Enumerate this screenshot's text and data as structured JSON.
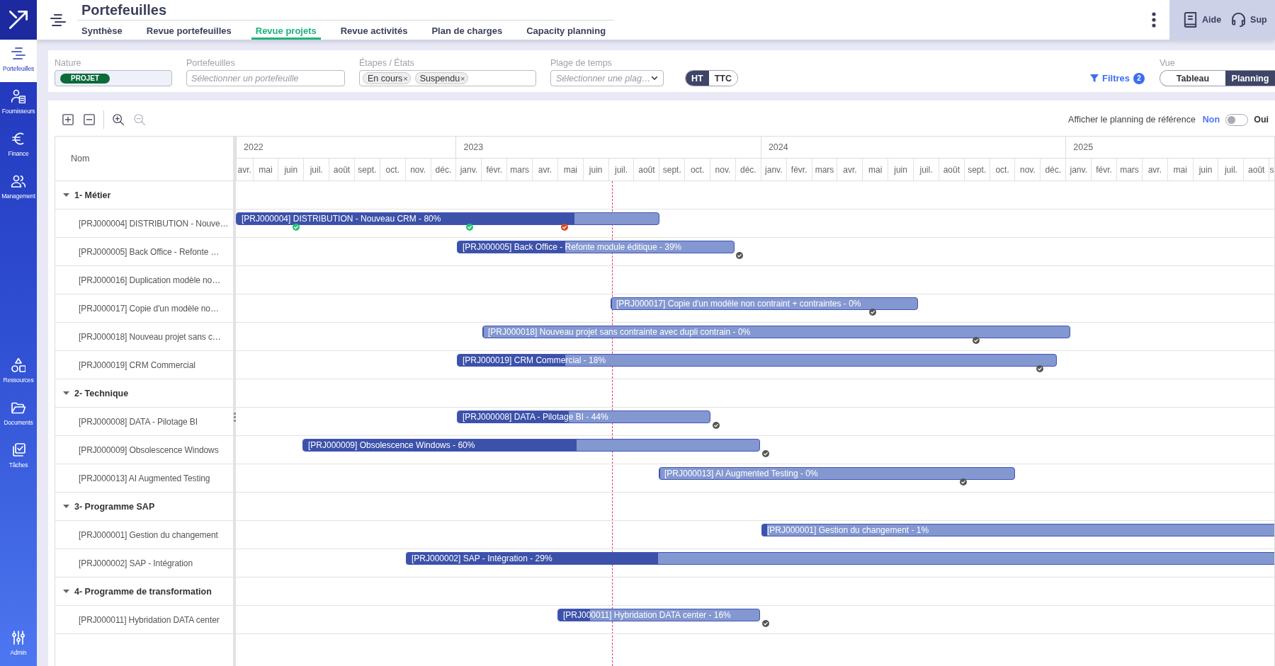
{
  "sidebar": {
    "items": [
      {
        "label": "Portefeuilles",
        "selected": true
      },
      {
        "label": "Fournisseurs",
        "selected": false
      },
      {
        "label": "Finance",
        "selected": false
      },
      {
        "label": "Management",
        "selected": false
      },
      {
        "label": "Ressources",
        "selected": false
      },
      {
        "label": "Documents",
        "selected": false
      },
      {
        "label": "Tâches",
        "selected": false
      },
      {
        "label": "Admin",
        "selected": false
      }
    ]
  },
  "header": {
    "title": "Portefeuilles",
    "tabs": [
      {
        "label": "Synthèse",
        "selected": false
      },
      {
        "label": "Revue portefeuilles",
        "selected": false
      },
      {
        "label": "Revue projets",
        "selected": true
      },
      {
        "label": "Revue activités",
        "selected": false
      },
      {
        "label": "Plan de charges",
        "selected": false
      },
      {
        "label": "Capacity planning",
        "selected": false
      }
    ],
    "links": [
      {
        "label": "Aide"
      },
      {
        "label": "Sup"
      }
    ]
  },
  "filters": {
    "fields": [
      {
        "kind": "tags",
        "label": "Nature",
        "tags": [
          "PROJET"
        ]
      },
      {
        "kind": "input",
        "label": "Portefeuilles",
        "placeholder": "Sélectionner un portefeuille"
      },
      {
        "kind": "chips",
        "label": "Étapes / États",
        "chips": [
          {
            "label": "En cours",
            "remove": "×"
          },
          {
            "label": "Suspendu",
            "remove": "×"
          }
        ]
      },
      {
        "kind": "select",
        "label": "Plage de temps",
        "placeholder": "Sélectionner une plag…"
      }
    ],
    "currency": [
      {
        "label": "HT",
        "selected": true
      },
      {
        "label": "TTC",
        "selected": false
      }
    ],
    "filter_button": {
      "label": "Filtres",
      "count": "2"
    },
    "view": {
      "label": "Vue",
      "options": [
        {
          "label": "Tableau",
          "selected": false
        },
        {
          "label": "Planning",
          "selected": true
        }
      ]
    }
  },
  "toolbar": {
    "tools": [
      {
        "kind": "expand",
        "disabled": false
      },
      {
        "kind": "collapse",
        "disabled": false
      },
      {
        "kind": "zoom_in",
        "disabled": false
      },
      {
        "kind": "zoom_out",
        "disabled": true
      }
    ],
    "reference": {
      "label": "Afficher le planning de référence",
      "off_label": "Non",
      "on_label": "Oui",
      "on": false
    }
  },
  "gantt": {
    "name_header": "Nom",
    "years": [
      {
        "label": "2022",
        "months": [
          "avr.",
          "mai",
          "juin",
          "juil.",
          "août",
          "sept.",
          "oct.",
          "nov.",
          "déc."
        ]
      },
      {
        "label": "2023",
        "months": [
          "janv.",
          "févr.",
          "mars",
          "avr.",
          "mai",
          "juin",
          "juil.",
          "août",
          "sept.",
          "oct.",
          "nov.",
          "déc."
        ]
      },
      {
        "label": "2024",
        "months": [
          "janv.",
          "févr.",
          "mars",
          "avr.",
          "mai",
          "juin",
          "juil.",
          "août",
          "sept.",
          "oct.",
          "nov.",
          "déc."
        ]
      },
      {
        "label": "2025",
        "months": [
          "janv.",
          "févr.",
          "mars",
          "avr.",
          "mai",
          "juin",
          "juil.",
          "août",
          "s"
        ]
      }
    ],
    "groups": [
      {
        "label": "1- Métier",
        "expanded": true,
        "children": [
          {
            "name": "[PRJ000004] DISTRIBUTION - Nouve…",
            "bar": {
              "label": "[PRJ000004] DISTRIBUTION - Nouveau CRM - 80%",
              "level": 0.8,
              "milestones": [
                {
                  "color": "#2bbf7b"
                },
                {
                  "color": "#2bbf7b"
                },
                {
                  "color": "#d9481f"
                }
              ]
            }
          },
          {
            "name": "[PRJ000005] Back Office - Refonte …",
            "bar": {
              "label": "[PRJ000005] Back Office - Refonte module éditique - 39%",
              "level": 0.39,
              "milestones": [
                {
                  "color": "#555555"
                }
              ]
            }
          },
          {
            "name": "[PRJ000016] Duplication modèle no…"
          },
          {
            "name": "[PRJ000017] Copie d'un modèle no…",
            "bar": {
              "label": "[PRJ000017] Copie d'un modèle non contraint + contraintes - 0%",
              "level": 0,
              "milestones": [
                {
                  "color": "#555555"
                }
              ]
            }
          },
          {
            "name": "[PRJ000018] Nouveau projet sans c…",
            "bar": {
              "label": "[PRJ000018] Nouveau projet sans contrainte avec dupli contrain - 0%",
              "level": 0,
              "milestones": [
                {
                  "color": "#555555"
                }
              ]
            }
          },
          {
            "name": "[PRJ000019] CRM Commercial",
            "bar": {
              "label": "[PRJ000019] CRM Commercial - 18%",
              "level": 0.18,
              "milestones": [
                {
                  "color": "#555555"
                }
              ]
            }
          }
        ]
      },
      {
        "label": "2- Technique",
        "expanded": true,
        "children": [
          {
            "name": "[PRJ000008] DATA - Pilotage BI",
            "bar": {
              "label": "[PRJ000008] DATA - Pilotage BI - 44%",
              "level": 0.44,
              "milestones": [
                {
                  "color": "#555555"
                }
              ]
            }
          },
          {
            "name": "[PRJ000009] Obsolescence Windows",
            "bar": {
              "label": "[PRJ000009] Obsolescence Windows - 60%",
              "level": 0.6,
              "milestones": [
                {
                  "color": "#555555"
                }
              ]
            }
          },
          {
            "name": "[PRJ000013] AI Augmented Testing",
            "bar": {
              "label": "[PRJ000013] AI Augmented Testing - 0%",
              "level": 0,
              "milestones": [
                {
                  "color": "#555555"
                }
              ]
            }
          }
        ]
      },
      {
        "label": "3- Programme SAP",
        "expanded": true,
        "children": [
          {
            "name": "[PRJ000001] Gestion du changement",
            "bar": {
              "label": "[PRJ000001] Gestion du changement - 1%",
              "level": 0.01
            }
          },
          {
            "name": "[PRJ000002] SAP - Intégration",
            "bar": {
              "label": "[PRJ000002] SAP - Intégration - 29%",
              "level": 0.29
            }
          }
        ]
      },
      {
        "label": "4- Programme de transformation",
        "expanded": true,
        "children": [
          {
            "name": "[PRJ000011] Hybridation DATA center",
            "bar": {
              "label": "[PRJ000011] Hybridation DATA center - 16%",
              "level": 0.16,
              "milestones": [
                {
                  "color": "#555555"
                }
              ]
            }
          }
        ]
      }
    ]
  }
}
